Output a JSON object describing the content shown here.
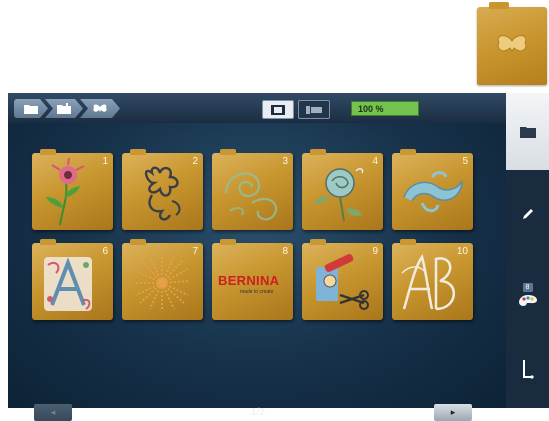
{
  "thumbnail": {
    "icon": "butterfly-icon"
  },
  "breadcrumb": [
    {
      "icon": "folder-icon"
    },
    {
      "icon": "folder-embroidery-icon"
    },
    {
      "icon": "butterfly-icon"
    }
  ],
  "view_toggle": [
    {
      "icon": "grid-view-icon",
      "active": true
    },
    {
      "icon": "list-view-icon",
      "active": false
    }
  ],
  "zoom": {
    "label": "100 %"
  },
  "folders": [
    {
      "number": "1",
      "motif": "flower-stem"
    },
    {
      "number": "2",
      "motif": "dark-floral"
    },
    {
      "number": "3",
      "motif": "green-swirl"
    },
    {
      "number": "4",
      "motif": "rose"
    },
    {
      "number": "5",
      "motif": "blue-swirl"
    },
    {
      "number": "6",
      "motif": "ornate-letter-a"
    },
    {
      "number": "7",
      "motif": "starburst"
    },
    {
      "number": "8",
      "motif": "bernina-logo",
      "logo_text": "BERNINA",
      "logo_sub": "made to create"
    },
    {
      "number": "9",
      "motif": "scissors-tools"
    },
    {
      "number": "10",
      "motif": "monogram-ab"
    }
  ],
  "pagination": {
    "label": "1/2"
  },
  "sidebar": [
    {
      "icon": "folder-icon"
    },
    {
      "icon": "pencil-icon"
    },
    {
      "icon": "palette-icon",
      "badge": "8"
    },
    {
      "icon": "stitch-icon"
    }
  ],
  "colors": {
    "folder": "#c8962f",
    "accent_green": "#74c24f",
    "background": "#163149"
  }
}
